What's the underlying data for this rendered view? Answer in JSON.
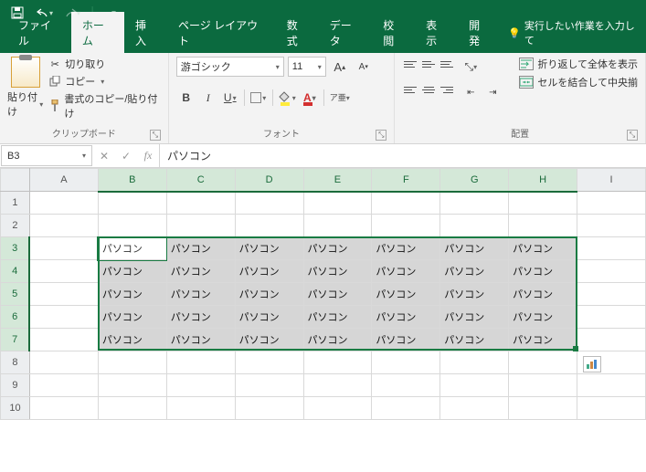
{
  "qat": {
    "save": "💾",
    "undo": "↶",
    "redo": "↷"
  },
  "tabs": {
    "file": "ファイル",
    "home": "ホーム",
    "insert": "挿入",
    "layout": "ページ レイアウト",
    "formula": "数式",
    "data": "データ",
    "review": "校閲",
    "view": "表示",
    "dev": "開発",
    "tell": "実行したい作業を入力して"
  },
  "clipboard": {
    "paste": "貼り付け",
    "cut": "切り取り",
    "copy": "コピー",
    "painter": "書式のコピー/貼り付け",
    "group": "クリップボード"
  },
  "font": {
    "name": "游ゴシック",
    "size": "11",
    "group": "フォント",
    "b": "B",
    "i": "I",
    "u": "U",
    "grow": "A",
    "shrink": "A",
    "color": "A",
    "ruby": "ア亜"
  },
  "align": {
    "group": "配置",
    "wrap": "折り返して全体を表示",
    "merge": "セルを結合して中央揃"
  },
  "namebox": "B3",
  "fxvalue": "パソコン",
  "cols": [
    "A",
    "B",
    "C",
    "D",
    "E",
    "F",
    "G",
    "H",
    "I"
  ],
  "rows": [
    "1",
    "2",
    "3",
    "4",
    "5",
    "6",
    "7",
    "8",
    "9",
    "10"
  ],
  "cellText": "パソコン",
  "chart_data": {
    "type": "table",
    "selection": "B3:H7",
    "active_cell": "B3",
    "cells": [
      {
        "row": 3,
        "cols": [
          "B",
          "C",
          "D",
          "E",
          "F",
          "G",
          "H"
        ],
        "value": "パソコン"
      },
      {
        "row": 4,
        "cols": [
          "B",
          "C",
          "D",
          "E",
          "F",
          "G",
          "H"
        ],
        "value": "パソコン"
      },
      {
        "row": 5,
        "cols": [
          "B",
          "C",
          "D",
          "E",
          "F",
          "G",
          "H"
        ],
        "value": "パソコン"
      },
      {
        "row": 6,
        "cols": [
          "B",
          "C",
          "D",
          "E",
          "F",
          "G",
          "H"
        ],
        "value": "パソコン"
      },
      {
        "row": 7,
        "cols": [
          "B",
          "C",
          "D",
          "E",
          "F",
          "G",
          "H"
        ],
        "value": "パソコン"
      }
    ]
  }
}
